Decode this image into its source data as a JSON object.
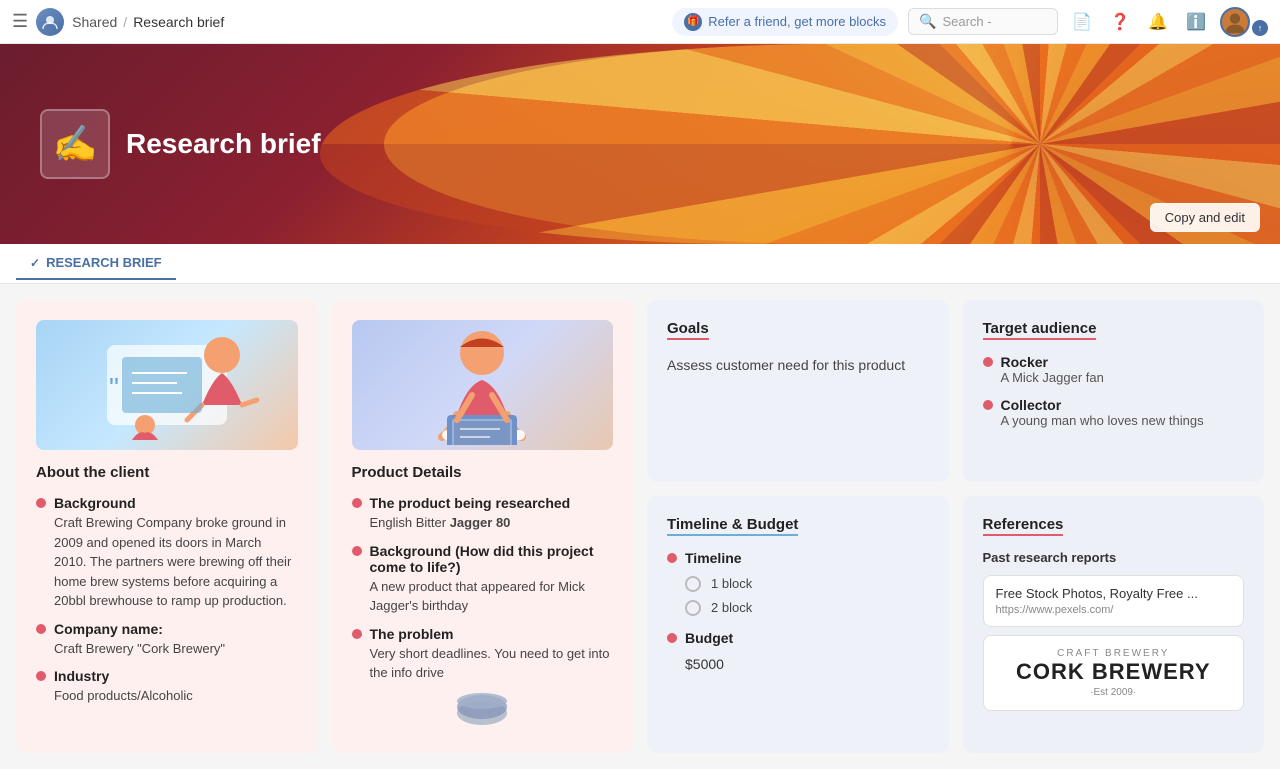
{
  "nav": {
    "hamburger": "☰",
    "workspace_label": "S",
    "shared_label": "Shared",
    "breadcrumb_separator": "/",
    "page_title": "Research brief",
    "refer_label": "Refer a friend, get more blocks",
    "search_placeholder": "Search -",
    "nav_icons": [
      "📄",
      "❓",
      "🔔",
      "❓"
    ],
    "copy_edit_label": "Copy and edit"
  },
  "hero": {
    "icon": "✍️",
    "title": "Research brief",
    "bg_color_left": "#6b1d2e",
    "bg_color_right": "#f0a040"
  },
  "tabs": [
    {
      "id": "research-brief",
      "label": "RESEARCH BRIEF",
      "active": true
    }
  ],
  "cards": {
    "client": {
      "title": "About the client",
      "bullets": [
        {
          "label": "Background",
          "text": "Craft Brewing Company broke ground in 2009 and opened its doors in March 2010. The partners were brewing off their home brew systems before acquiring a 20bbl brewhouse to ramp up production."
        },
        {
          "label": "Company name:",
          "text": "Craft Brewery \"Cork Brewery\""
        },
        {
          "label": "Industry",
          "text": "Food products/Alcoholic"
        }
      ]
    },
    "product": {
      "title": "Product Details",
      "bullets": [
        {
          "label": "The product being researched",
          "text": "English Bitter Jagger 80"
        },
        {
          "label": "Background (How did this project come to life?)",
          "text": "A new product that appeared for Mick Jagger's birthday"
        },
        {
          "label": "The problem",
          "text": "Very short deadlines. You need to get into the info drive"
        }
      ]
    },
    "goals": {
      "title": "Goals",
      "text": "Assess customer need for this product"
    },
    "target": {
      "title": "Target audience",
      "items": [
        {
          "person": "Rocker",
          "description": "A Mick Jagger fan"
        },
        {
          "person": "Collector",
          "description": "A young man who loves new things"
        }
      ]
    },
    "timeline": {
      "title": "Timeline & Budget",
      "timeline_label": "Timeline",
      "blocks": [
        "1 block",
        "2 block"
      ],
      "budget_label": "Budget",
      "budget_value": "$5000"
    },
    "references": {
      "title": "References",
      "sub_title": "Past research reports",
      "links": [
        {
          "title": "Free Stock Photos, Royalty Free ...",
          "url": "https://www.pexels.com/"
        }
      ],
      "brewery": {
        "sub": "CRAFT BREWERY",
        "name": "CORK BREWERY",
        "est": "·Est 2009·"
      }
    }
  }
}
